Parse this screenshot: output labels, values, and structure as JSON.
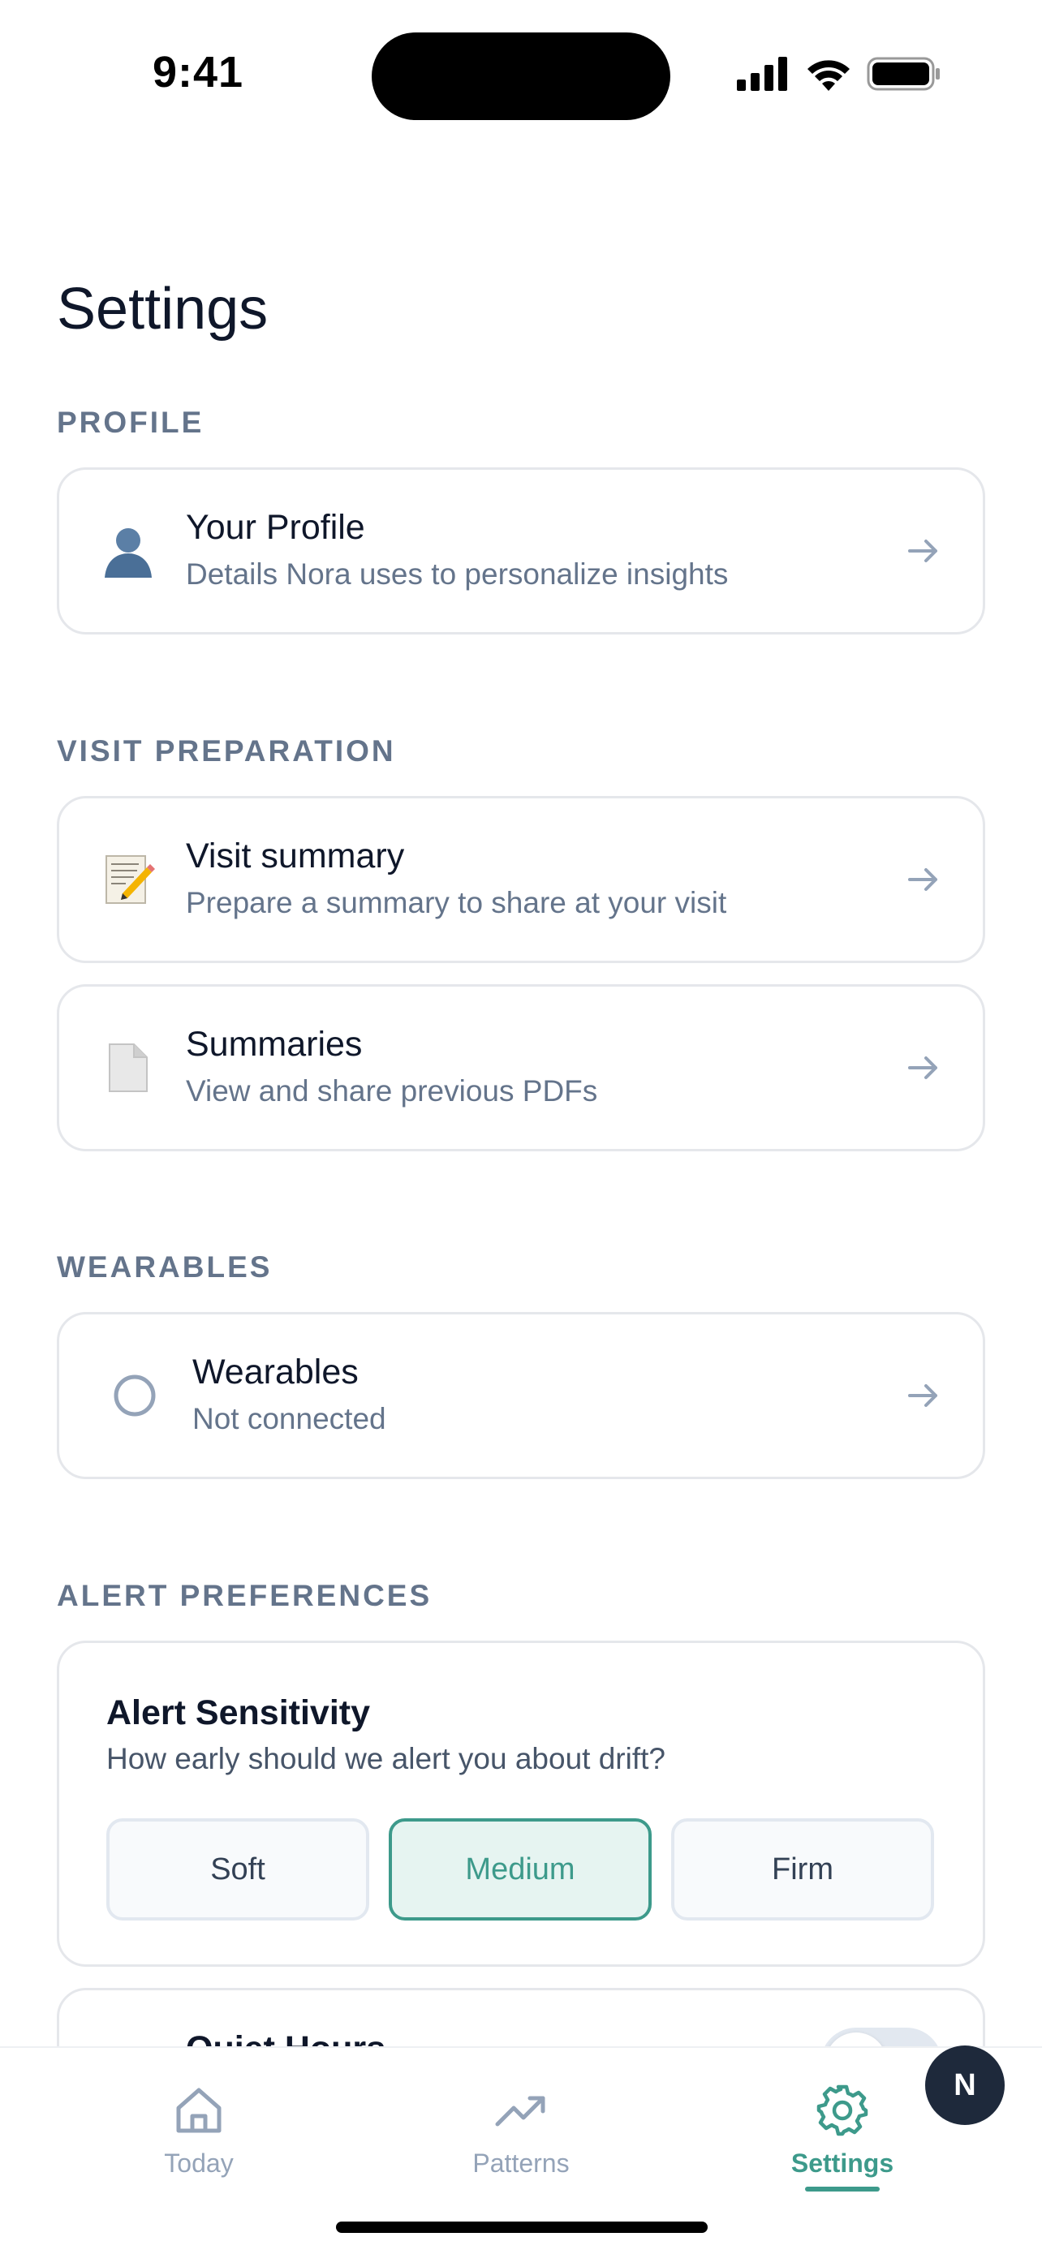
{
  "status_bar": {
    "time": "9:41"
  },
  "page_title": "Settings",
  "sections": {
    "profile": {
      "label": "PROFILE",
      "items": [
        {
          "icon": "person-icon",
          "title": "Your Profile",
          "subtitle": "Details Nora uses to personalize insights"
        }
      ]
    },
    "visit": {
      "label": "VISIT PREPARATION",
      "items": [
        {
          "icon": "memo-icon",
          "title": "Visit summary",
          "subtitle": "Prepare a summary to share at your visit"
        },
        {
          "icon": "document-icon",
          "title": "Summaries",
          "subtitle": "View and share previous PDFs"
        }
      ]
    },
    "wearables": {
      "label": "WEARABLES",
      "items": [
        {
          "icon": "status-circle-icon",
          "title": "Wearables",
          "subtitle": "Not connected"
        }
      ]
    },
    "alerts": {
      "label": "ALERT PREFERENCES",
      "sensitivity": {
        "title": "Alert Sensitivity",
        "subtitle": "How early should we alert you about drift?",
        "options": [
          "Soft",
          "Medium",
          "Firm"
        ],
        "selected": "Medium"
      },
      "quiet_hours": {
        "title": "Quiet Hours",
        "enabled": false
      }
    }
  },
  "tab_bar": {
    "tabs": [
      {
        "label": "Today",
        "icon": "home-icon"
      },
      {
        "label": "Patterns",
        "icon": "trend-icon"
      },
      {
        "label": "Settings",
        "icon": "gear-icon"
      }
    ],
    "active": "Settings",
    "avatar_initial": "N"
  },
  "colors": {
    "accent": "#3d9a8b",
    "muted": "#64748b",
    "border": "#e5e7eb"
  }
}
